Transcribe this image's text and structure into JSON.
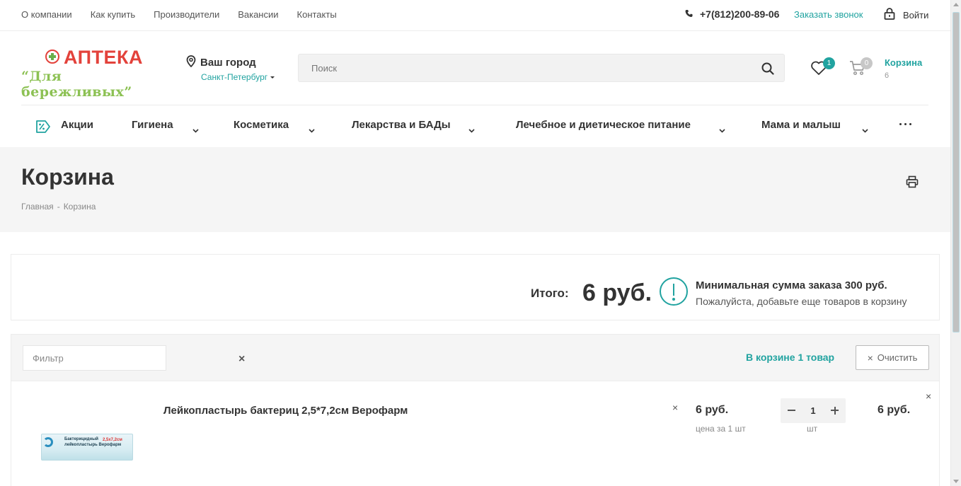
{
  "topbar": {
    "nav": [
      "О компании",
      "Как купить",
      "Производители",
      "Вакансии",
      "Контакты"
    ],
    "phone": "+7(812)200-89-06",
    "callback": "Заказать звонок",
    "login": "Войти"
  },
  "logo": {
    "line1": "АПТЕКА",
    "line2": "“Для бережливых”"
  },
  "city": {
    "label": "Ваш город",
    "value": "Санкт-Петербург"
  },
  "search": {
    "placeholder": "Поиск"
  },
  "favorites": {
    "count": "1"
  },
  "cart": {
    "count": "0",
    "label": "Корзина",
    "sum": "6"
  },
  "menu": {
    "items": [
      "Акции",
      "Гигиена",
      "Косметика",
      "Лекарства и БАДы",
      "Лечебное и диетическое питание",
      "Мама и малыш"
    ]
  },
  "page": {
    "title": "Корзина",
    "breadcrumbs": [
      "Главная",
      "-",
      "Корзина"
    ]
  },
  "summary": {
    "total_label": "Итого:",
    "total_value": "6 руб.",
    "min_order": "Минимальная сумма заказа 300 руб.",
    "hint": "Пожалуйста, добавьте еще товаров в корзину"
  },
  "filter": {
    "placeholder": "Фильтр",
    "clear_x": "×",
    "count_text": "В корзине 1 товар",
    "clear_button": "Очистить"
  },
  "item": {
    "name": "Лейкопластырь бактериц 2,5*7,2см Верофарм",
    "thumb_text": "Бактерицидный лейкопластырь Верофарм",
    "thumb_size": "2,5x7,2см",
    "remove": "×",
    "price": "6 руб.",
    "price_sub": "цена за 1 шт",
    "qty": "1",
    "qty_unit": "шт",
    "total": "6 руб.",
    "delete": "×"
  },
  "colors": {
    "accent": "#21a3a0",
    "brand_red": "#e3423b",
    "brand_green": "#8cc153"
  }
}
